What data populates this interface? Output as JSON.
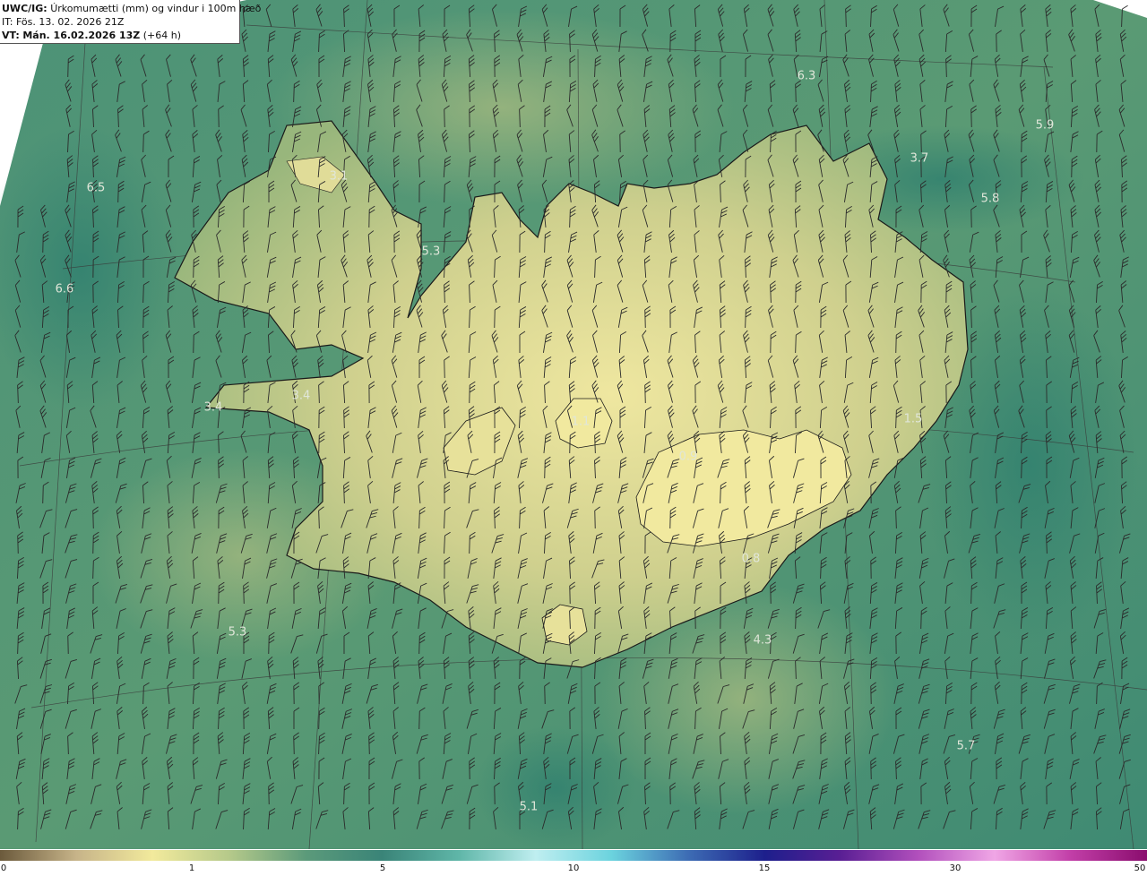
{
  "header": {
    "model_label": "UWC/IG:",
    "product_title": "Úrkomumætti (mm) og vindur i 100m hæð",
    "initial_time": "IT: Fös. 13. 02. 2026 21Z",
    "valid_label": "VT:",
    "valid_time": "Mán. 16.02.2026 13Z",
    "lead_time": "(+64 h)"
  },
  "value_labels": [
    {
      "text": "6.3"
    },
    {
      "text": "5.9"
    },
    {
      "text": "3.7"
    },
    {
      "text": "5.8"
    },
    {
      "text": "3.1"
    },
    {
      "text": "6.5"
    },
    {
      "text": "5.3"
    },
    {
      "text": "6.6"
    },
    {
      "text": "3.4"
    },
    {
      "text": "3.4"
    },
    {
      "text": "1.1"
    },
    {
      "text": "0.9"
    },
    {
      "text": "1.5"
    },
    {
      "text": "0.8"
    },
    {
      "text": "5.3"
    },
    {
      "text": "4.3"
    },
    {
      "text": "5.7"
    },
    {
      "text": "5.1"
    }
  ],
  "colorbar": {
    "ticks": [
      "0",
      "1",
      "5",
      "10",
      "15",
      "30",
      "50"
    ],
    "colors": [
      "#6b5a3c",
      "#c7b489",
      "#f2ea9c",
      "#b5c98a",
      "#5b9a7a",
      "#3a8478",
      "#5fb6a8",
      "#bfeef0",
      "#6bd3de",
      "#3d6cb4",
      "#1d1f8c",
      "#5a1f94",
      "#b14fbc",
      "#f0a6e6",
      "#c23fa8",
      "#8a0d6e"
    ]
  },
  "colors": {
    "sea": "#3f8a73",
    "land_low": "#a6bd80",
    "land_high": "#ede59c",
    "coast": "#1a1a1a",
    "grid": "#3a3a3a"
  }
}
